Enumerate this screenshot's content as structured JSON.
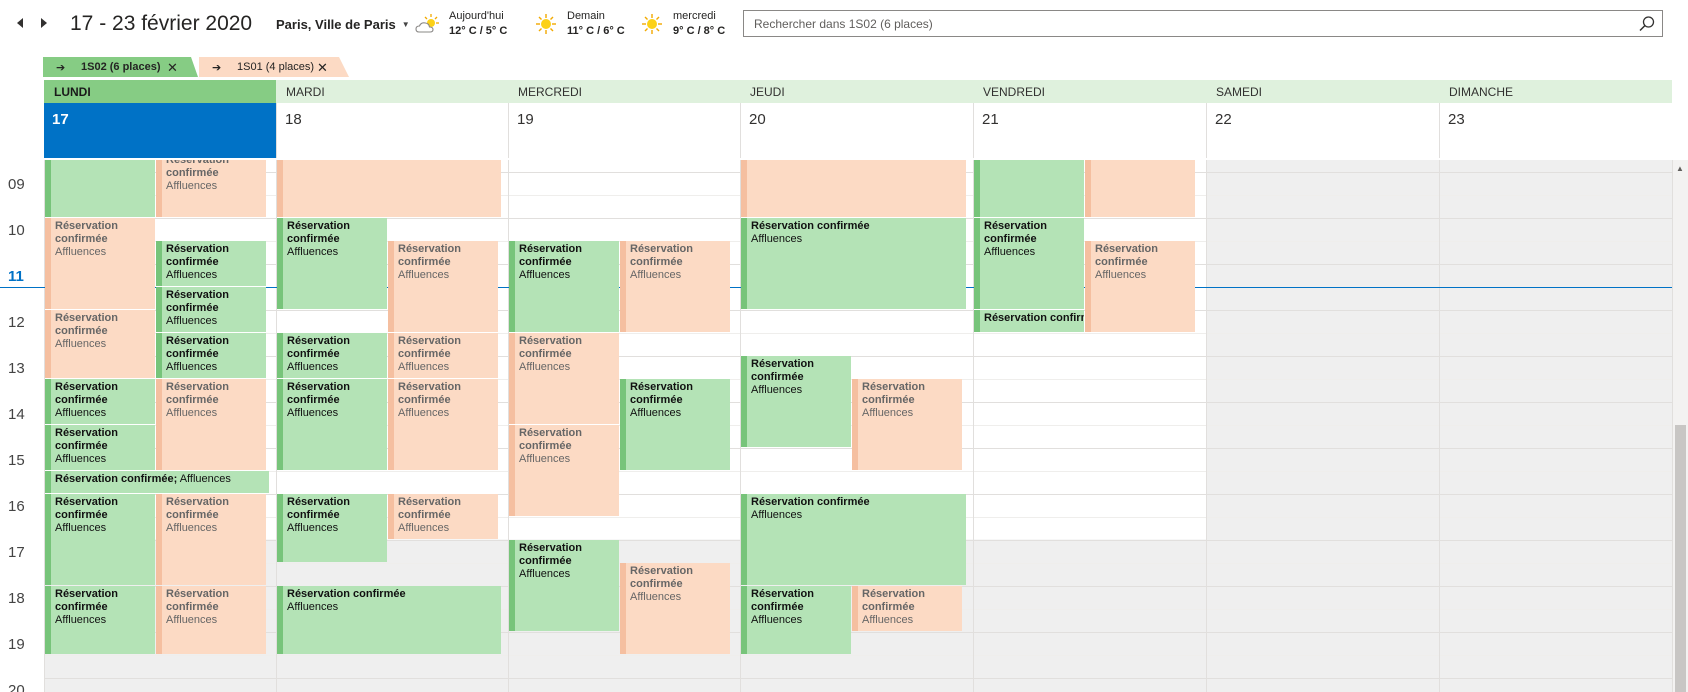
{
  "toolbar": {
    "prev_label": "◀",
    "next_label": "▶",
    "date_range": "17 - 23 février 2020",
    "location": "Paris, Ville de Paris",
    "location_caret": "▼",
    "weather": [
      {
        "label": "Aujourd'hui",
        "temps": "12° C / 5° C",
        "icon": "cloudy-sun-icon"
      },
      {
        "label": "Demain",
        "temps": "11° C / 6° C",
        "icon": "sun-icon"
      },
      {
        "label": "mercredi",
        "temps": "9° C / 8° C",
        "icon": "sun-icon"
      }
    ],
    "search_placeholder": "Rechercher dans 1S02 (6 places)"
  },
  "calendar_tabs": [
    {
      "label": "1S02 (6 places)",
      "color": "#86cc84",
      "active": true
    },
    {
      "label": "1S01 (4 places)",
      "color": "#fcdac4",
      "active": false
    }
  ],
  "tab_arrow": "➔",
  "tab_close": "✕",
  "days": [
    {
      "name": "LUNDI",
      "num": "17",
      "today": true
    },
    {
      "name": "MARDI",
      "num": "18",
      "today": false
    },
    {
      "name": "MERCREDI",
      "num": "19",
      "today": false
    },
    {
      "name": "JEUDI",
      "num": "20",
      "today": false
    },
    {
      "name": "VENDREDI",
      "num": "21",
      "today": false
    },
    {
      "name": "SAMEDI",
      "num": "22",
      "today": false
    },
    {
      "name": "DIMANCHE",
      "num": "23",
      "today": false
    }
  ],
  "hours": [
    "09",
    "10",
    "11",
    "12",
    "13",
    "14",
    "15",
    "16",
    "17",
    "18",
    "19",
    "20"
  ],
  "current_hour": "11",
  "event_title": "Réservation confirmée",
  "event_subtitle": "Affluences",
  "event_inline_title": "Réservation confirmée;",
  "colors": {
    "green_event": "#b4e3b6",
    "green_bar": "#77c47a",
    "orange_event": "#fcdac4",
    "orange_bar": "#f5bfa0",
    "today_header": "#0072c6",
    "day_header": "#dff1dd"
  },
  "events": [
    {
      "day": 0,
      "sub": 0,
      "start": 8.75,
      "end": 10,
      "color": "green",
      "notext": true
    },
    {
      "day": 0,
      "sub": 1,
      "start": 8.75,
      "end": 10,
      "color": "orange",
      "title": "Réservation confirmée",
      "sub_text": "Affluences",
      "cut": true
    },
    {
      "day": 0,
      "sub": 0,
      "start": 10,
      "end": 12,
      "color": "orange",
      "title": "Réservation confirmée",
      "sub_text": "Affluences"
    },
    {
      "day": 0,
      "sub": 1,
      "start": 10.5,
      "end": 11.5,
      "color": "green",
      "title": "Réservation confirmée",
      "sub_text": "Affluences"
    },
    {
      "day": 0,
      "sub": 1,
      "start": 11.5,
      "end": 12.5,
      "color": "green",
      "title": "Réservation confirmée",
      "sub_text": "Affluences"
    },
    {
      "day": 0,
      "sub": 0,
      "start": 12,
      "end": 13.5,
      "color": "orange",
      "title": "Réservation confirmée",
      "sub_text": "Affluences"
    },
    {
      "day": 0,
      "sub": 1,
      "start": 12.5,
      "end": 13.5,
      "color": "green",
      "title": "Réservation confirmée",
      "sub_text": "Affluences"
    },
    {
      "day": 0,
      "sub": 0,
      "start": 13.5,
      "end": 14.5,
      "color": "green",
      "title": "Réservation confirmée",
      "sub_text": "Affluences"
    },
    {
      "day": 0,
      "sub": 1,
      "start": 13.5,
      "end": 15.5,
      "color": "orange",
      "title": "Réservation confirmée",
      "sub_text": "Affluences"
    },
    {
      "day": 0,
      "sub": 0,
      "start": 14.5,
      "end": 15.5,
      "color": "green",
      "title": "Réservation confirmée",
      "sub_text": "Affluences"
    },
    {
      "day": 0,
      "sub": -1,
      "start": 15.5,
      "end": 16,
      "color": "green",
      "title": "Réservation confirmée;",
      "sub_text": "Affluences",
      "inline": true
    },
    {
      "day": 0,
      "sub": 0,
      "start": 16,
      "end": 18,
      "color": "green",
      "title": "Réservation confirmée",
      "sub_text": "Affluences"
    },
    {
      "day": 0,
      "sub": 1,
      "start": 16,
      "end": 18,
      "color": "orange",
      "title": "Réservation confirmée",
      "sub_text": "Affluences"
    },
    {
      "day": 0,
      "sub": 0,
      "start": 18,
      "end": 19.5,
      "color": "green",
      "title": "Réservation confirmée",
      "sub_text": "Affluences"
    },
    {
      "day": 0,
      "sub": 1,
      "start": 18,
      "end": 19.5,
      "color": "orange",
      "title": "Réservation confirmée",
      "sub_text": "Affluences"
    },
    {
      "day": 1,
      "sub": -1,
      "start": 8.75,
      "end": 10,
      "color": "orange",
      "notext": true
    },
    {
      "day": 1,
      "sub": 0,
      "start": 10,
      "end": 12,
      "color": "green",
      "title": "Réservation confirmée",
      "sub_text": "Affluences"
    },
    {
      "day": 1,
      "sub": 1,
      "start": 10.5,
      "end": 12.5,
      "color": "orange",
      "title": "Réservation confirmée",
      "sub_text": "Affluences"
    },
    {
      "day": 1,
      "sub": 0,
      "start": 12.5,
      "end": 13.5,
      "color": "green",
      "title": "Réservation confirmée",
      "sub_text": "Affluences"
    },
    {
      "day": 1,
      "sub": 1,
      "start": 12.5,
      "end": 13.5,
      "color": "orange",
      "title": "Réservation confirmée",
      "sub_text": "Affluences"
    },
    {
      "day": 1,
      "sub": 0,
      "start": 13.5,
      "end": 15.5,
      "color": "green",
      "title": "Réservation confirmée",
      "sub_text": "Affluences"
    },
    {
      "day": 1,
      "sub": 1,
      "start": 13.5,
      "end": 15.5,
      "color": "orange",
      "title": "Réservation confirmée",
      "sub_text": "Affluences"
    },
    {
      "day": 1,
      "sub": 0,
      "start": 16,
      "end": 17.5,
      "color": "green",
      "title": "Réservation confirmée",
      "sub_text": "Affluences"
    },
    {
      "day": 1,
      "sub": 1,
      "start": 16,
      "end": 17,
      "color": "orange",
      "title": "Réservation confirmée",
      "sub_text": "Affluences"
    },
    {
      "day": 1,
      "sub": -1,
      "start": 18,
      "end": 19.5,
      "color": "green",
      "title": "Réservation confirmée",
      "sub_text": "Affluences"
    },
    {
      "day": 2,
      "sub": 0,
      "start": 10.5,
      "end": 12.5,
      "color": "green",
      "title": "Réservation confirmée",
      "sub_text": "Affluences"
    },
    {
      "day": 2,
      "sub": 1,
      "start": 10.5,
      "end": 12.5,
      "color": "orange",
      "title": "Réservation confirmée",
      "sub_text": "Affluences"
    },
    {
      "day": 2,
      "sub": 0,
      "start": 12.5,
      "end": 14.5,
      "color": "orange",
      "title": "Réservation confirmée",
      "sub_text": "Affluences"
    },
    {
      "day": 2,
      "sub": 1,
      "start": 13.5,
      "end": 15.5,
      "color": "green",
      "title": "Réservation confirmée",
      "sub_text": "Affluences"
    },
    {
      "day": 2,
      "sub": 0,
      "start": 14.5,
      "end": 16.5,
      "color": "orange",
      "title": "Réservation confirmée",
      "sub_text": "Affluences"
    },
    {
      "day": 2,
      "sub": 0,
      "start": 17,
      "end": 19,
      "color": "green",
      "title": "Réservation confirmée",
      "sub_text": "Affluences"
    },
    {
      "day": 2,
      "sub": 1,
      "start": 17.5,
      "end": 19.5,
      "color": "orange",
      "title": "Réservation confirmée",
      "sub_text": "Affluences"
    },
    {
      "day": 3,
      "sub": -1,
      "start": 8.75,
      "end": 10,
      "color": "orange",
      "notext": true
    },
    {
      "day": 3,
      "sub": -1,
      "start": 10,
      "end": 12,
      "color": "green",
      "title": "Réservation confirmée",
      "sub_text": "Affluences",
      "single": true
    },
    {
      "day": 3,
      "sub": 0,
      "start": 13,
      "end": 15,
      "color": "green",
      "title": "Réservation confirmée",
      "sub_text": "Affluences"
    },
    {
      "day": 3,
      "sub": 1,
      "start": 13.5,
      "end": 15.5,
      "color": "orange",
      "title": "Réservation confirmée",
      "sub_text": "Affluences"
    },
    {
      "day": 3,
      "sub": -1,
      "start": 16,
      "end": 18,
      "color": "green",
      "title": "Réservation confirmée",
      "sub_text": "Affluences",
      "single": true
    },
    {
      "day": 3,
      "sub": 0,
      "start": 18,
      "end": 19.5,
      "color": "green",
      "title": "Réservation confirmée",
      "sub_text": "Affluences"
    },
    {
      "day": 3,
      "sub": 1,
      "start": 18,
      "end": 19,
      "color": "orange",
      "title": "Réservation confirmée",
      "sub_text": "Affluences"
    },
    {
      "day": 4,
      "sub": 0,
      "start": 8.75,
      "end": 10,
      "color": "green",
      "notext": true
    },
    {
      "day": 4,
      "sub": 1,
      "start": 8.75,
      "end": 10,
      "color": "orange",
      "notext": true
    },
    {
      "day": 4,
      "sub": 0,
      "start": 10,
      "end": 12,
      "color": "green",
      "title": "Réservation confirmée",
      "sub_text": "Affluences"
    },
    {
      "day": 4,
      "sub": 1,
      "start": 10.5,
      "end": 12.5,
      "color": "orange",
      "title": "Réservation confirmée",
      "sub_text": "Affluences"
    },
    {
      "day": 4,
      "sub": 0,
      "start": 12,
      "end": 12.5,
      "color": "green",
      "title": "Réservation confirmée",
      "sub_text": "",
      "single": true
    }
  ]
}
